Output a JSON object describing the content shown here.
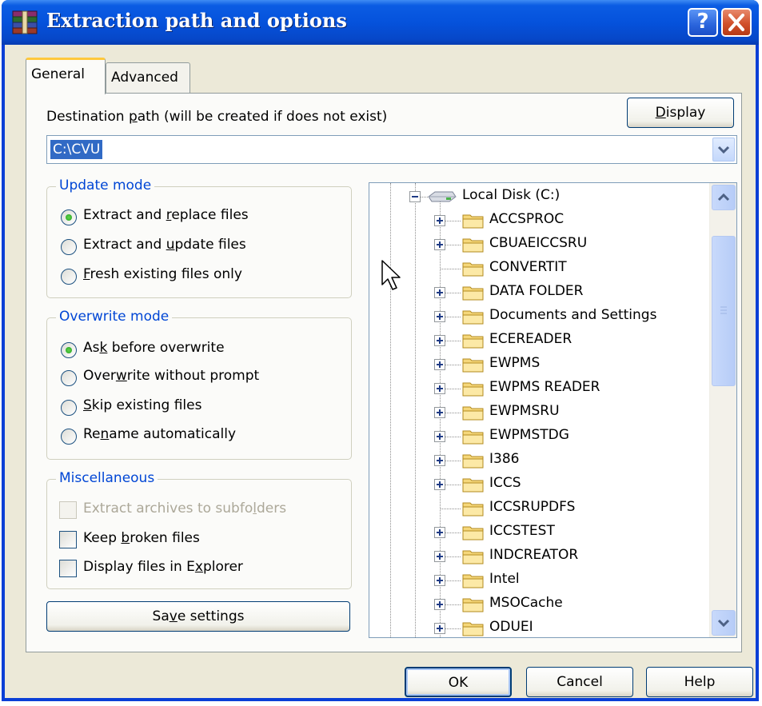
{
  "window": {
    "title": "Extraction path and options"
  },
  "tabs": [
    {
      "label": "General",
      "active": true
    },
    {
      "label": "Advanced",
      "active": false
    }
  ],
  "destination": {
    "label_pre": "Destination ",
    "label_accel": "p",
    "label_post": "ath (will be created if does not exist)",
    "value": "C:\\CVU",
    "display_button": {
      "accel": "D",
      "rest": "isplay"
    }
  },
  "update_mode": {
    "title": "Update mode",
    "options": [
      {
        "pre": "Extract and ",
        "accel": "r",
        "post": "eplace files",
        "selected": true
      },
      {
        "pre": "Extract and ",
        "accel": "u",
        "post": "pdate files",
        "selected": false
      },
      {
        "pre": "",
        "accel": "F",
        "post": "resh existing files only",
        "selected": false
      }
    ]
  },
  "overwrite_mode": {
    "title": "Overwrite mode",
    "options": [
      {
        "pre": "As",
        "accel": "k",
        "post": " before overwrite",
        "selected": true
      },
      {
        "pre": "Over",
        "accel": "w",
        "post": "rite without prompt",
        "selected": false
      },
      {
        "pre": "",
        "accel": "S",
        "post": "kip existing files",
        "selected": false
      },
      {
        "pre": "Re",
        "accel": "n",
        "post": "ame automatically",
        "selected": false
      }
    ]
  },
  "miscellaneous": {
    "title": "Miscellaneous",
    "options": [
      {
        "pre": "Extract archives to subfo",
        "accel": "l",
        "post": "ders",
        "checked": false,
        "disabled": true
      },
      {
        "pre": "Keep ",
        "accel": "b",
        "post": "roken files",
        "checked": false,
        "disabled": false
      },
      {
        "pre": "Display files in E",
        "accel": "x",
        "post": "plorer",
        "checked": false,
        "disabled": false
      }
    ]
  },
  "save_settings": {
    "pre": "Sa",
    "accel": "v",
    "post": "e settings"
  },
  "tree": {
    "root": "Local Disk (C:)",
    "items": [
      {
        "name": "ACCSPROC",
        "expandable": true
      },
      {
        "name": "CBUAEICCSRU",
        "expandable": true
      },
      {
        "name": "CONVERTIT",
        "expandable": false
      },
      {
        "name": "DATA FOLDER",
        "expandable": true
      },
      {
        "name": "Documents and Settings",
        "expandable": true
      },
      {
        "name": "ECEREADER",
        "expandable": true
      },
      {
        "name": "EWPMS",
        "expandable": true
      },
      {
        "name": "EWPMS READER",
        "expandable": true
      },
      {
        "name": "EWPMSRU",
        "expandable": true
      },
      {
        "name": "EWPMSTDG",
        "expandable": true
      },
      {
        "name": "I386",
        "expandable": true
      },
      {
        "name": "ICCS",
        "expandable": true
      },
      {
        "name": "ICCSRUPDFS",
        "expandable": false
      },
      {
        "name": "ICCSTEST",
        "expandable": true
      },
      {
        "name": "INDCREATOR",
        "expandable": true
      },
      {
        "name": "Intel",
        "expandable": true
      },
      {
        "name": "MSOCache",
        "expandable": true
      },
      {
        "name": "ODUEI",
        "expandable": true
      }
    ]
  },
  "footer": {
    "ok": "OK",
    "cancel": "Cancel",
    "help": "Help"
  },
  "colors": {
    "titlebar": "#0552dc",
    "dialog_bg": "#ece9d8",
    "group_title": "#0046d5",
    "selection": "#316ac5",
    "folder": "#f5d77a"
  }
}
